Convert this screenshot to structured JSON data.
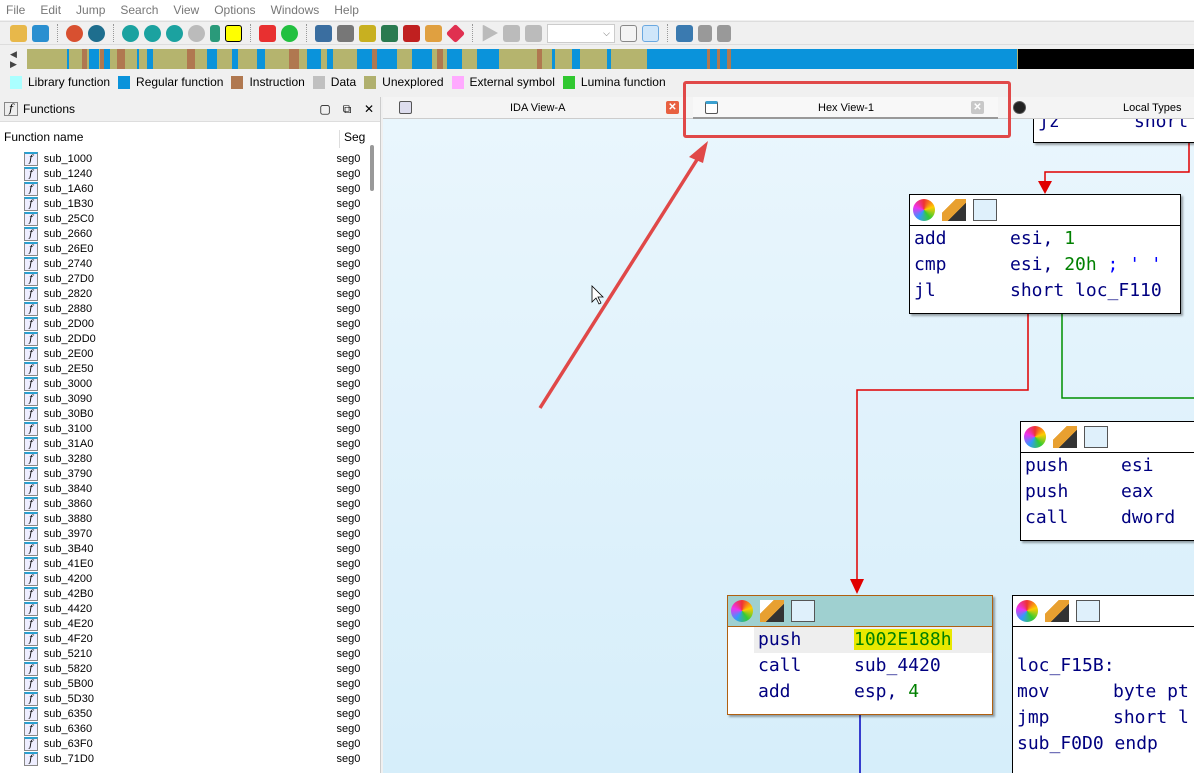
{
  "menu": [
    "File",
    "Edit",
    "Jump",
    "Search",
    "View",
    "Options",
    "Windows",
    "Help"
  ],
  "legend": [
    {
      "label": "Library function",
      "color": "#aaffff"
    },
    {
      "label": "Regular function",
      "color": "#0a93db"
    },
    {
      "label": "Instruction",
      "color": "#b07850"
    },
    {
      "label": "Data",
      "color": "#c0c0c0"
    },
    {
      "label": "Unexplored",
      "color": "#b0b06e"
    },
    {
      "label": "External symbol",
      "color": "#ffaaff"
    },
    {
      "label": "Lumina function",
      "color": "#30c830"
    }
  ],
  "functions_panel": {
    "title": "Functions",
    "col_name": "Function name",
    "col_seg": "Seg",
    "rows": [
      "sub_1000",
      "sub_1240",
      "sub_1A60",
      "sub_1B30",
      "sub_25C0",
      "sub_2660",
      "sub_26E0",
      "sub_2740",
      "sub_27D0",
      "sub_2820",
      "sub_2880",
      "sub_2D00",
      "sub_2DD0",
      "sub_2E00",
      "sub_2E50",
      "sub_3000",
      "sub_3090",
      "sub_30B0",
      "sub_3100",
      "sub_31A0",
      "sub_3280",
      "sub_3790",
      "sub_3840",
      "sub_3860",
      "sub_3880",
      "sub_3970",
      "sub_3B40",
      "sub_41E0",
      "sub_4200",
      "sub_42B0",
      "sub_4420",
      "sub_4E20",
      "sub_4F20",
      "sub_5210",
      "sub_5820",
      "sub_5B00",
      "sub_5D30",
      "sub_6350",
      "sub_6360",
      "sub_63F0",
      "sub_71D0"
    ],
    "seg": "seg0"
  },
  "tabs": {
    "ida": "IDA View-A",
    "hex": "Hex View-1",
    "local": "Local Types"
  },
  "blocks": {
    "b1": [
      [
        "jz",
        "short"
      ]
    ],
    "b2": [
      [
        "add",
        "esi, ",
        "1",
        ""
      ],
      [
        "cmp",
        "esi, ",
        "20h",
        " ; ' '"
      ],
      [
        "jl",
        "short loc_F110",
        "",
        ""
      ]
    ],
    "b3": [
      [
        "push",
        "esi"
      ],
      [
        "push",
        "eax"
      ],
      [
        "call",
        "dword"
      ]
    ],
    "b4": [
      [
        "push",
        "1002E188h"
      ],
      [
        "call",
        "sub_4420"
      ],
      [
        "add",
        "esp, ",
        "4"
      ]
    ],
    "b5": {
      "label": "loc_F15B:",
      "lines": [
        [
          "mov",
          "byte pt"
        ],
        [
          "jmp",
          "short l"
        ]
      ],
      "endp": "sub_F0D0 endp"
    }
  },
  "colors": {
    "accent_red": "#e04848",
    "edge_red": "#e00000",
    "edge_green": "#009000",
    "edge_blue": "#0000c0"
  }
}
